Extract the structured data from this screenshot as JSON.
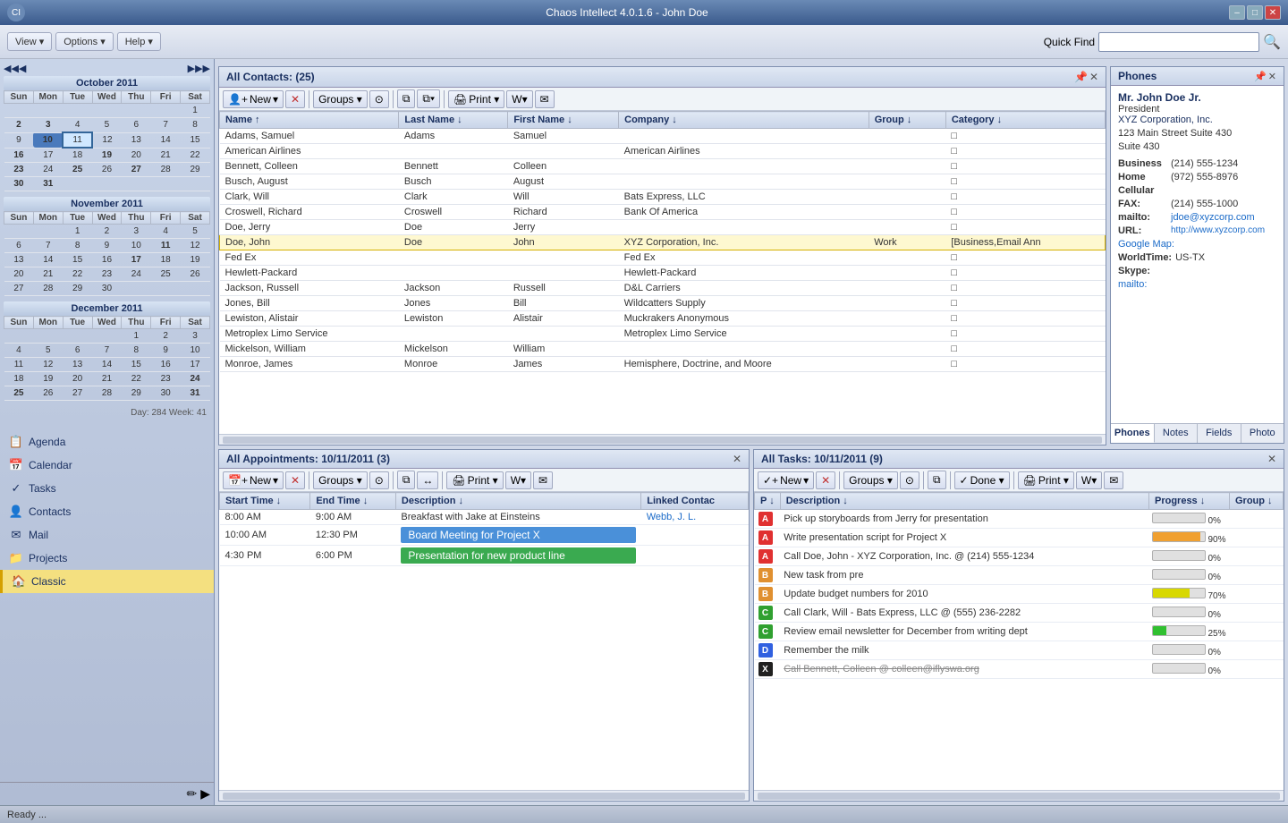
{
  "titlebar": {
    "title": "Chaos Intellect 4.0.1.6 - John Doe",
    "min_label": "–",
    "max_label": "□",
    "close_label": "✕"
  },
  "toolbar": {
    "view_label": "View ▾",
    "options_label": "Options ▾",
    "help_label": "Help ▾",
    "quickfind_label": "Quick Find",
    "quickfind_placeholder": ""
  },
  "sidebar": {
    "nav_items": [
      {
        "id": "agenda",
        "icon": "📋",
        "label": "Agenda"
      },
      {
        "id": "calendar",
        "icon": "📅",
        "label": "Calendar"
      },
      {
        "id": "tasks",
        "icon": "✓",
        "label": "Tasks"
      },
      {
        "id": "contacts",
        "icon": "👤",
        "label": "Contacts"
      },
      {
        "id": "mail",
        "icon": "✉",
        "label": "Mail"
      },
      {
        "id": "projects",
        "icon": "📁",
        "label": "Projects"
      },
      {
        "id": "classic",
        "icon": "🏠",
        "label": "Classic"
      }
    ],
    "calendar": {
      "months": [
        {
          "name": "October 2011",
          "days_header": [
            "Sun",
            "Mon",
            "Tue",
            "Wed",
            "Thu",
            "Fri",
            "Sat"
          ],
          "weeks": [
            [
              "",
              "",
              "",
              "",
              "",
              "",
              "1"
            ],
            [
              "2",
              "3",
              "4",
              "5",
              "6",
              "7",
              "8"
            ],
            [
              "9",
              "10",
              "11",
              "12",
              "13",
              "14",
              "15"
            ],
            [
              "16",
              "17",
              "18",
              "19",
              "20",
              "21",
              "22"
            ],
            [
              "23",
              "24",
              "25",
              "26",
              "27",
              "28",
              "29"
            ],
            [
              "30",
              "31",
              "",
              "",
              "",
              "",
              ""
            ]
          ],
          "today": "10",
          "selected": "11",
          "red_days": [
            "2",
            "9",
            "16",
            "23",
            "30",
            "8",
            "15",
            "22",
            "29"
          ],
          "bold_days": [
            "3",
            "10",
            "11",
            "19",
            "25",
            "27"
          ]
        },
        {
          "name": "November 2011",
          "days_header": [
            "Sun",
            "Mon",
            "Tue",
            "Wed",
            "Thu",
            "Fri",
            "Sat"
          ],
          "weeks": [
            [
              "",
              "",
              "1",
              "2",
              "3",
              "4",
              "5"
            ],
            [
              "6",
              "7",
              "8",
              "9",
              "10",
              "11",
              "12"
            ],
            [
              "13",
              "14",
              "15",
              "16",
              "17",
              "18",
              "19"
            ],
            [
              "20",
              "21",
              "22",
              "23",
              "24",
              "25",
              "26"
            ],
            [
              "27",
              "28",
              "29",
              "30",
              "",
              "",
              ""
            ]
          ],
          "red_days": [
            "6",
            "13",
            "20",
            "27",
            "5",
            "12",
            "19",
            "26"
          ],
          "bold_days": [
            "11",
            "17"
          ]
        },
        {
          "name": "December 2011",
          "days_header": [
            "Sun",
            "Mon",
            "Tue",
            "Wed",
            "Thu",
            "Fri",
            "Sat"
          ],
          "weeks": [
            [
              "",
              "",
              "",
              "",
              "1",
              "2",
              "3"
            ],
            [
              "4",
              "5",
              "6",
              "7",
              "8",
              "9",
              "10"
            ],
            [
              "11",
              "12",
              "13",
              "14",
              "15",
              "16",
              "17"
            ],
            [
              "18",
              "19",
              "20",
              "21",
              "22",
              "23",
              "24"
            ],
            [
              "25",
              "26",
              "27",
              "28",
              "29",
              "30",
              "31"
            ]
          ],
          "red_days": [
            "4",
            "11",
            "18",
            "25",
            "3",
            "10",
            "17",
            "24",
            "31"
          ],
          "bold_days": [
            "24",
            "25",
            "31"
          ]
        }
      ],
      "dayweek_info": "Day: 284  Week: 41"
    }
  },
  "contacts_panel": {
    "title": "All Contacts:  (25)",
    "toolbar": {
      "new_label": "New",
      "delete_icon": "✕",
      "groups_label": "Groups ▾",
      "filter_icon": "⊙",
      "copy_icon": "⧉",
      "print_label": "Print ▾",
      "word_icon": "W ▾",
      "email_icon": "✉"
    },
    "columns": [
      "Name ↑",
      "Last Name ↓",
      "First Name ↓",
      "Company ↓",
      "Group ↓",
      "Category ↓"
    ],
    "rows": [
      {
        "name": "Adams, Samuel",
        "last": "Adams",
        "first": "Samuel",
        "company": "",
        "group": "",
        "cat": "□"
      },
      {
        "name": "American Airlines",
        "last": "",
        "first": "",
        "company": "American Airlines",
        "group": "",
        "cat": "□"
      },
      {
        "name": "Bennett, Colleen",
        "last": "Bennett",
        "first": "Colleen",
        "company": "",
        "group": "",
        "cat": "□"
      },
      {
        "name": "Busch, August",
        "last": "Busch",
        "first": "August",
        "company": "",
        "group": "",
        "cat": "□"
      },
      {
        "name": "Clark, Will",
        "last": "Clark",
        "first": "Will",
        "company": "Bats Express, LLC",
        "group": "",
        "cat": "□"
      },
      {
        "name": "Croswell, Richard",
        "last": "Croswell",
        "first": "Richard",
        "company": "Bank Of America",
        "group": "",
        "cat": "□"
      },
      {
        "name": "Doe, Jerry",
        "last": "Doe",
        "first": "Jerry",
        "company": "",
        "group": "",
        "cat": "□"
      },
      {
        "name": "Doe, John",
        "last": "Doe",
        "first": "John",
        "company": "XYZ Corporation, Inc.",
        "group": "Work",
        "cat": "[Business,Email Ann",
        "selected": true
      },
      {
        "name": "Fed Ex",
        "last": "",
        "first": "",
        "company": "Fed Ex",
        "group": "",
        "cat": "□"
      },
      {
        "name": "Hewlett-Packard",
        "last": "",
        "first": "",
        "company": "Hewlett-Packard",
        "group": "",
        "cat": "□"
      },
      {
        "name": "Jackson, Russell",
        "last": "Jackson",
        "first": "Russell",
        "company": "D&L Carriers",
        "group": "",
        "cat": "□"
      },
      {
        "name": "Jones, Bill",
        "last": "Jones",
        "first": "Bill",
        "company": "Wildcatters Supply",
        "group": "",
        "cat": "□"
      },
      {
        "name": "Lewiston, Alistair",
        "last": "Lewiston",
        "first": "Alistair",
        "company": "Muckrakers Anonymous",
        "group": "",
        "cat": "□"
      },
      {
        "name": "Metroplex Limo Service",
        "last": "",
        "first": "",
        "company": "Metroplex Limo Service",
        "group": "",
        "cat": "□"
      },
      {
        "name": "Mickelson, William",
        "last": "Mickelson",
        "first": "William",
        "company": "",
        "group": "",
        "cat": "□"
      },
      {
        "name": "Monroe, James",
        "last": "Monroe",
        "first": "James",
        "company": "Hemisphere, Doctrine, and Moore",
        "group": "",
        "cat": "□"
      }
    ]
  },
  "appointments_panel": {
    "title": "All Appointments: 10/11/2011  (3)",
    "toolbar": {
      "new_label": "New",
      "groups_label": "Groups ▾",
      "print_label": "Print ▾"
    },
    "columns": [
      "Start Time ↓",
      "End Time ↓",
      "Description ↓",
      "Linked Contac"
    ],
    "rows": [
      {
        "start": "8:00 AM",
        "end": "9:00 AM",
        "desc": "Breakfast with Jake at Einsteins",
        "contact": "Webb, J. L.",
        "style": "normal"
      },
      {
        "start": "10:00 AM",
        "end": "12:30 PM",
        "desc": "Board Meeting for Project X",
        "contact": "",
        "style": "blue"
      },
      {
        "start": "4:30 PM",
        "end": "6:00 PM",
        "desc": "Presentation for new product line",
        "contact": "",
        "style": "green"
      }
    ]
  },
  "tasks_panel": {
    "title": "All Tasks: 10/11/2011  (9)",
    "toolbar": {
      "new_label": "New",
      "groups_label": "Groups ▾",
      "done_label": "Done ▾",
      "print_label": "Print ▾"
    },
    "columns": [
      "P ↓",
      "Description ↓",
      "Progress ↓",
      "Group ↓"
    ],
    "rows": [
      {
        "priority": "A",
        "pclass": "p-a",
        "desc": "Pick up storyboards from Jerry for presentation",
        "progress": 0,
        "prog_class": "prog-0",
        "group": "",
        "strikethrough": false
      },
      {
        "priority": "A",
        "pclass": "p-a",
        "desc": "Write presentation script for Project X",
        "progress": 90,
        "prog_class": "prog-90",
        "group": "",
        "strikethrough": false
      },
      {
        "priority": "A",
        "pclass": "p-a",
        "desc": "Call Doe, John - XYZ Corporation, Inc. @ (214) 555-1234",
        "progress": 0,
        "prog_class": "prog-0",
        "group": "",
        "strikethrough": false
      },
      {
        "priority": "B",
        "pclass": "p-b",
        "desc": "New task from pre",
        "progress": 0,
        "prog_class": "prog-0",
        "group": "",
        "strikethrough": false
      },
      {
        "priority": "B",
        "pclass": "p-b",
        "desc": "Update budget numbers for 2010",
        "progress": 70,
        "prog_class": "prog-70",
        "group": "",
        "strikethrough": false
      },
      {
        "priority": "C",
        "pclass": "p-c",
        "desc": "Call Clark, Will - Bats Express, LLC @ (555) 236-2282",
        "progress": 0,
        "prog_class": "prog-0",
        "group": "",
        "strikethrough": false
      },
      {
        "priority": "C",
        "pclass": "p-c",
        "desc": "Review email newsletter for December from writing dept",
        "progress": 25,
        "prog_class": "prog-25",
        "group": "",
        "strikethrough": false
      },
      {
        "priority": "D",
        "pclass": "p-d",
        "desc": "Remember the milk",
        "progress": 0,
        "prog_class": "prog-0",
        "group": "",
        "strikethrough": false
      },
      {
        "priority": "X",
        "pclass": "p-x",
        "desc": "Call Bennett, Colleen @ colleen@iflyswa.org",
        "progress": 0,
        "prog_class": "prog-0",
        "group": "",
        "strikethrough": true
      }
    ]
  },
  "phones_panel": {
    "title": "Phones",
    "contact_name": "Mr. John Doe Jr.",
    "contact_title": "President",
    "contact_company": "XYZ Corporation, Inc.",
    "contact_address": "123 Main Street Suite 430\nSuite 430",
    "fields": [
      {
        "label": "Business",
        "value": "(214) 555-1234"
      },
      {
        "label": "Home",
        "value": "(972) 555-8976"
      },
      {
        "label": "Cellular",
        "value": ""
      },
      {
        "label": "FAX:",
        "value": "(214) 555-1000"
      },
      {
        "label": "mailto:",
        "value": "jdoe@xyzcorp.com",
        "link": true
      },
      {
        "label": "URL:",
        "value": "http://www.xyzcorp.com",
        "link": true
      },
      {
        "label": "Google Map:",
        "value": ""
      },
      {
        "label": "WorldTime:",
        "value": "US-TX"
      },
      {
        "label": "Skype:",
        "value": ""
      },
      {
        "label": "mailto:",
        "value": "",
        "link": false
      }
    ],
    "tabs": [
      "Phones",
      "Notes",
      "Fields",
      "Photo"
    ]
  },
  "statusbar": {
    "text": "Ready ..."
  }
}
